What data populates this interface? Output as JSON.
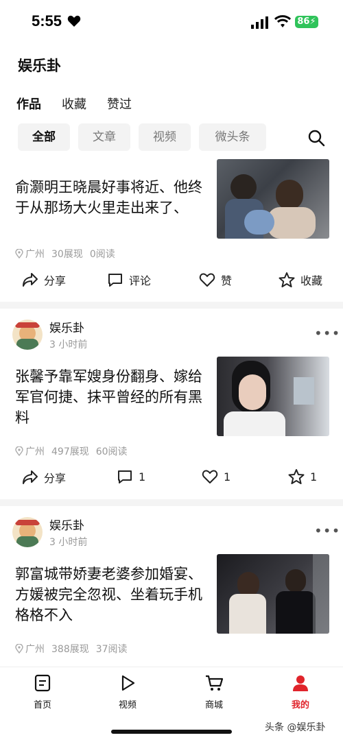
{
  "status_bar": {
    "time": "5:55",
    "battery": "86"
  },
  "header": {
    "account_name": "娱乐卦"
  },
  "tabs": [
    {
      "label": "作品",
      "active": true
    },
    {
      "label": "收藏",
      "active": false
    },
    {
      "label": "赞过",
      "active": false
    }
  ],
  "filters": [
    {
      "label": "全部",
      "active": true
    },
    {
      "label": "文章",
      "active": false
    },
    {
      "label": "视频",
      "active": false
    },
    {
      "label": "微头条",
      "active": false
    }
  ],
  "posts": [
    {
      "title": "俞灏明王晓晨好事将近、他终于从那场大火里走出来了、",
      "location": "广州",
      "views": "30展现",
      "reads": "0阅读",
      "share": "分享",
      "comment": "评论",
      "like": "赞",
      "favorite": "收藏"
    },
    {
      "author": "娱乐卦",
      "time": "3 小时前",
      "title": "张馨予靠军嫂身份翻身、嫁给军官何捷、抹平曾经的所有黑料",
      "location": "广州",
      "views": "497展现",
      "reads": "60阅读",
      "share": "分享",
      "comment": "1",
      "like": "1",
      "favorite": "1"
    },
    {
      "author": "娱乐卦",
      "time": "3 小时前",
      "title": "郭富城带娇妻老婆参加婚宴、方媛被完全忽视、坐着玩手机格格不入",
      "location": "广州",
      "views": "388展现",
      "reads": "37阅读"
    }
  ],
  "bottom_nav": [
    {
      "label": "首页",
      "icon": "home-icon"
    },
    {
      "label": "视频",
      "icon": "play-icon"
    },
    {
      "label": "商城",
      "icon": "cart-icon"
    },
    {
      "label": "我的",
      "icon": "profile-icon",
      "active": true
    }
  ],
  "watermark": "头条 @娱乐卦",
  "colors": {
    "accent": "#e0242b",
    "battery": "#2fc35a"
  }
}
